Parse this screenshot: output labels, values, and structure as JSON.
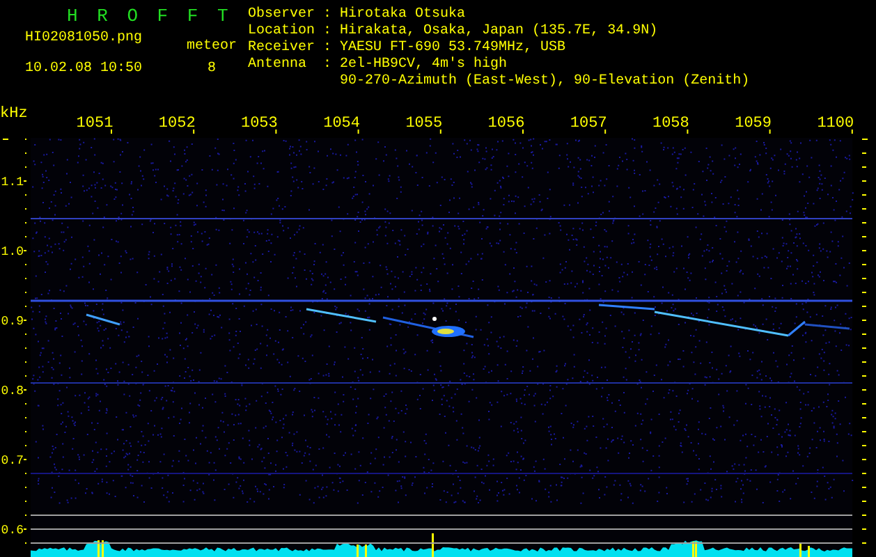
{
  "header": {
    "title": "H R O F F T",
    "filename": "HI02081050.png",
    "timestamp": "10.02.08 10:50",
    "counter": {
      "label": "meteor",
      "value": "8"
    }
  },
  "station_info": [
    {
      "label": "Observer",
      "separator": ":",
      "lines": [
        "Hirotaka Otsuka"
      ]
    },
    {
      "label": "Location",
      "separator": ":",
      "lines": [
        "Hirakata, Osaka, Japan (135.7E, 34.9N)"
      ]
    },
    {
      "label": "Receiver",
      "separator": ":",
      "lines": [
        "YAESU FT-690 53.749MHz, USB"
      ]
    },
    {
      "label": "Antenna",
      "separator": ":",
      "lines": [
        "2el-HB9CV, 4m's high",
        "90-270-Azimuth (East-West), 90-Elevation (Zenith)"
      ]
    }
  ],
  "spectrogram": {
    "unit_label": "kHz",
    "x_labels": [
      "1051",
      "1052",
      "1053",
      "1054",
      "1055",
      "1056",
      "1057",
      "1058",
      "1059",
      "1100"
    ],
    "y_labels": [
      "1.1",
      "1.0",
      "0.9",
      "0.8",
      "0.7",
      "0.6"
    ]
  }
}
